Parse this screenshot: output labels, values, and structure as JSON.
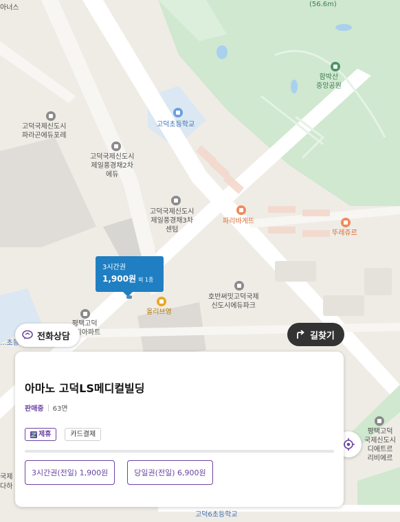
{
  "map": {
    "labels": {
      "top_left": "아너스",
      "elevation": "(56.6m)",
      "park": "함박산\n중앙공원",
      "school1": "고덕초등학교",
      "apt1": "고덕국제신도시\n파라곤에듀포레",
      "apt2": "고덕국제신도시\n제일풍경채2차\n에듀",
      "apt3": "고덕국제신도시\n제일풍경채3차\n센텀",
      "bakery": "파리바게뜨",
      "bakery2": "뚜레쥬르",
      "apt4": "호반써밋고덕국제\n신도시에듀파크",
      "oliveyoung": "올리브영",
      "apt5": "평택고덕\n국제신도시\n디에트르\n리비에르",
      "apt6": "평택고덕\n...지아파트",
      "school_left": "...초등학교",
      "left_edge_a": "국제",
      "left_edge_b": "다하",
      "school_bottom": "고덕6초등학교"
    },
    "icons": [
      "school-icon",
      "building-icon",
      "bakery-icon",
      "shopping-icon",
      "park-icon"
    ]
  },
  "price_marker": {
    "ticket": "3시간권",
    "price": "1,900원",
    "extra": "외 1종"
  },
  "buttons": {
    "consult": "전화상담",
    "directions": "길찾기"
  },
  "card": {
    "title": "아마노 고덕LS메디컬빌딩",
    "status": "판매중",
    "spaces": "63면",
    "tags": {
      "partner": "제휴",
      "card": "카드결제"
    },
    "tickets": [
      {
        "label": "3시간권(전일) 1,900원"
      },
      {
        "label": "당일권(전일) 6,900원"
      }
    ]
  },
  "colors": {
    "accent": "#6a43a3",
    "marker": "#1f7fc2",
    "park": "#cfe8cf"
  }
}
